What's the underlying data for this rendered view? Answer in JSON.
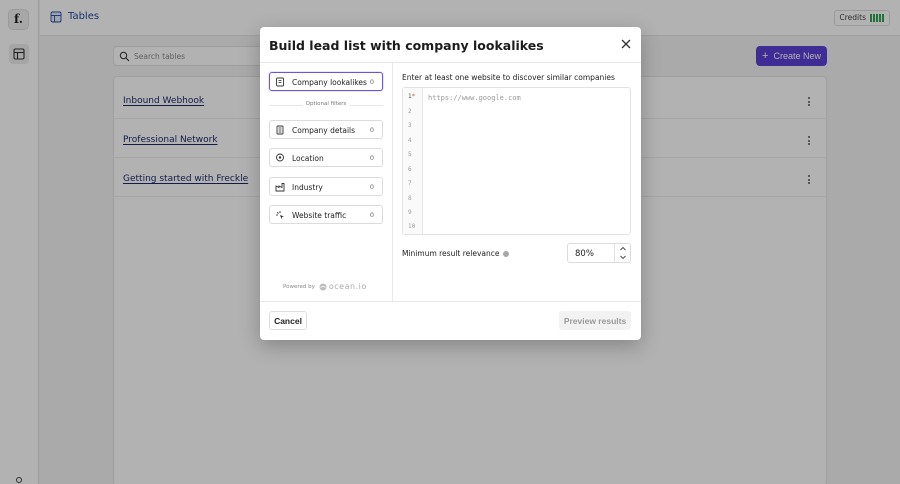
{
  "app": {
    "logo_text": "f.",
    "section_title": "Tables",
    "credits_label": "Credits",
    "search_placeholder": "Search tables",
    "create_label": "Create New",
    "tables": [
      {
        "name": "Inbound Webhook"
      },
      {
        "name": "Professional Network"
      },
      {
        "name": "Getting started with Freckle"
      }
    ]
  },
  "modal": {
    "title": "Build lead list with company lookalikes",
    "primary_filter": {
      "label": "Company lookalikes",
      "count": "0",
      "icon": "building-icon"
    },
    "optional_label": "Optional filters",
    "filters": [
      {
        "label": "Company details",
        "count": "0",
        "icon": "company-icon"
      },
      {
        "label": "Location",
        "count": "0",
        "icon": "location-pin-icon"
      },
      {
        "label": "Industry",
        "count": "0",
        "icon": "factory-icon"
      },
      {
        "label": "Website traffic",
        "count": "0",
        "icon": "traffic-icon"
      }
    ],
    "powered_by": "Powered by",
    "provider": "ocean.io",
    "prompt": "Enter at least one website to discover similar companies",
    "url_placeholder": "https://www.google.com",
    "line_numbers": [
      "1",
      "2",
      "3",
      "4",
      "5",
      "6",
      "7",
      "8",
      "9",
      "10"
    ],
    "required_marker": "*",
    "relevance_label": "Minimum result relevance",
    "relevance_value": "80%",
    "cancel_label": "Cancel",
    "preview_label": "Preview results"
  },
  "colors": {
    "accent": "#5c3fd6",
    "active_border": "#6b55da",
    "link": "#1e2a6b",
    "credits_green": "#2fa44f"
  }
}
